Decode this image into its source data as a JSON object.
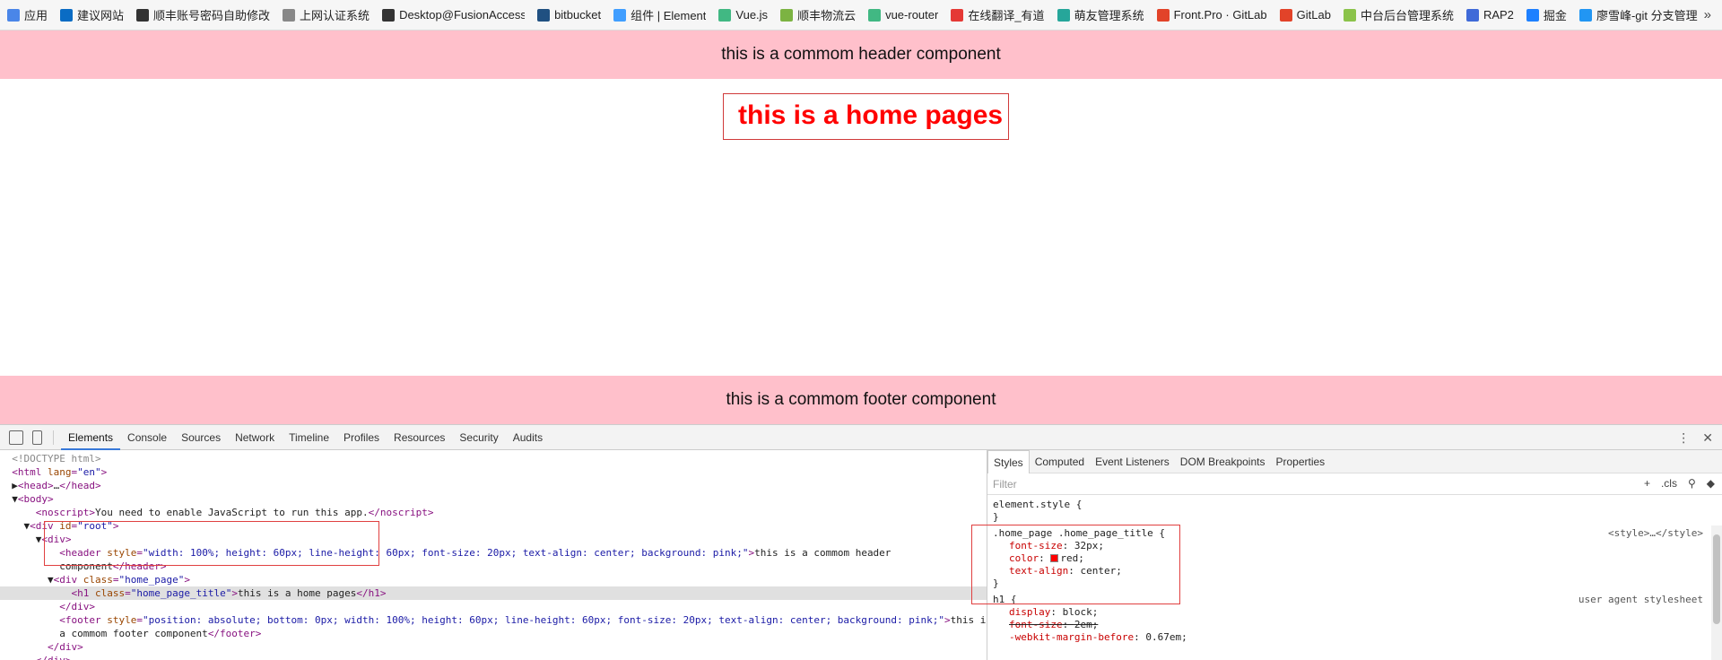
{
  "bookmarks": [
    {
      "label": "应用",
      "icon": "apps-grid-icon",
      "color": "#4a86e8"
    },
    {
      "label": "建议网站",
      "icon": "bing-icon",
      "color": "#0a6cc4"
    },
    {
      "label": "顺丰账号密码自助修改",
      "icon": "sf-icon",
      "color": "#333333"
    },
    {
      "label": "上网认证系统",
      "icon": "page-icon",
      "color": "#888888"
    },
    {
      "label": "Desktop@FusionAccess",
      "icon": "sf-icon",
      "color": "#333333"
    },
    {
      "label": "bitbucket",
      "icon": "bitbucket-icon",
      "color": "#205081"
    },
    {
      "label": "组件 | Element",
      "icon": "element-icon",
      "color": "#409eff"
    },
    {
      "label": "Vue.js",
      "icon": "vue-icon",
      "color": "#41b883"
    },
    {
      "label": "顺丰物流云",
      "icon": "cloud-icon",
      "color": "#7cb342"
    },
    {
      "label": "vue-router",
      "icon": "vue-icon",
      "color": "#41b883"
    },
    {
      "label": "在线翻译_有道",
      "icon": "youdao-icon",
      "color": "#e53935"
    },
    {
      "label": "萌友管理系统",
      "icon": "mengyou-icon",
      "color": "#26a69a"
    },
    {
      "label": "Front.Pro · GitLab",
      "icon": "gitlab-icon",
      "color": "#e24329"
    },
    {
      "label": "GitLab",
      "icon": "gitlab-icon",
      "color": "#e24329"
    },
    {
      "label": "中台后台管理系统",
      "icon": "leaf-icon",
      "color": "#8bc34a"
    },
    {
      "label": "RAP2",
      "icon": "rap-icon",
      "color": "#3f6ad8"
    },
    {
      "label": "掘金",
      "icon": "juejin-icon",
      "color": "#1e80ff"
    },
    {
      "label": "廖雪峰-git 分支管理",
      "icon": "liao-icon",
      "color": "#2196f3"
    }
  ],
  "bookmarks_more": "»",
  "page": {
    "header_text": "this is a commom header component",
    "home_title": "this is a home pages",
    "footer_text": "this is a commom footer component"
  },
  "devtools": {
    "tabs": [
      "Elements",
      "Console",
      "Sources",
      "Network",
      "Timeline",
      "Profiles",
      "Resources",
      "Security",
      "Audits"
    ],
    "active_tab": "Elements",
    "dom_lines": [
      {
        "indent": "  ",
        "parts": [
          [
            "cmt",
            "<!DOCTYPE html>"
          ]
        ]
      },
      {
        "indent": "  ",
        "parts": [
          [
            "tag",
            "<html "
          ],
          [
            "attr",
            "lang"
          ],
          [
            "tag",
            "="
          ],
          [
            "val",
            "\"en\""
          ],
          [
            "tag",
            ">"
          ]
        ]
      },
      {
        "indent": "  ▶",
        "parts": [
          [
            "tag",
            "<head>"
          ],
          [
            "txtc",
            "…"
          ],
          [
            "tag",
            "</head>"
          ]
        ]
      },
      {
        "indent": "  ▼",
        "parts": [
          [
            "tag",
            "<body>"
          ]
        ]
      },
      {
        "indent": "      ",
        "parts": [
          [
            "tag",
            "<noscript>"
          ],
          [
            "txtc",
            "You need to enable JavaScript to run this app."
          ],
          [
            "tag",
            "</noscript>"
          ]
        ]
      },
      {
        "indent": "    ▼",
        "parts": [
          [
            "tag",
            "<div "
          ],
          [
            "attr",
            "id"
          ],
          [
            "tag",
            "="
          ],
          [
            "val",
            "\"root\""
          ],
          [
            "tag",
            ">"
          ]
        ]
      },
      {
        "indent": "      ▼",
        "parts": [
          [
            "tag",
            "<div>"
          ]
        ]
      },
      {
        "indent": "          ",
        "parts": [
          [
            "tag",
            "<header "
          ],
          [
            "attr",
            "style"
          ],
          [
            "tag",
            "="
          ],
          [
            "val",
            "\"width: 100%; height: 60px; line-height: 60px; font-size: 20px; text-align: center; background: pink;\""
          ],
          [
            "tag",
            ">"
          ],
          [
            "txtc",
            "this is a commom header"
          ]
        ]
      },
      {
        "indent": "          ",
        "parts": [
          [
            "txtc",
            "component"
          ],
          [
            "tag",
            "</header>"
          ]
        ]
      },
      {
        "indent": "        ▼",
        "parts": [
          [
            "tag",
            "<div "
          ],
          [
            "attr",
            "class"
          ],
          [
            "tag",
            "="
          ],
          [
            "val",
            "\"home_page\""
          ],
          [
            "tag",
            ">"
          ]
        ]
      },
      {
        "indent": "            ",
        "parts": [
          [
            "tag",
            "<h1 "
          ],
          [
            "attr",
            "class"
          ],
          [
            "tag",
            "="
          ],
          [
            "val",
            "\"home_page_title\""
          ],
          [
            "tag",
            ">"
          ],
          [
            "txtc",
            "this is a home pages"
          ],
          [
            "tag",
            "</h1>"
          ]
        ],
        "selected": true
      },
      {
        "indent": "          ",
        "parts": [
          [
            "tag",
            "</div>"
          ]
        ]
      },
      {
        "indent": "          ",
        "parts": [
          [
            "tag",
            "<footer "
          ],
          [
            "attr",
            "style"
          ],
          [
            "tag",
            "="
          ],
          [
            "val",
            "\"position: absolute; bottom: 0px; width: 100%; height: 60px; line-height: 60px; font-size: 20px; text-align: center; background: pink;\""
          ],
          [
            "tag",
            ">"
          ],
          [
            "txtc",
            "this is"
          ]
        ]
      },
      {
        "indent": "          ",
        "parts": [
          [
            "txtc",
            "a commom footer component"
          ],
          [
            "tag",
            "</footer>"
          ]
        ]
      },
      {
        "indent": "        ",
        "parts": [
          [
            "tag",
            "</div>"
          ]
        ]
      },
      {
        "indent": "      ",
        "parts": [
          [
            "tag",
            "</div>"
          ]
        ]
      }
    ],
    "styles_tabs": [
      "Styles",
      "Computed",
      "Event Listeners",
      "DOM Breakpoints",
      "Properties"
    ],
    "styles_active": "Styles",
    "filter_placeholder": "Filter",
    "filter_tools": [
      "+",
      ".cls",
      "pin-icon",
      "palette-icon"
    ],
    "rules": {
      "element_style_open": "element.style {",
      "element_style_close": "}",
      "rule1_selector": ".home_page .home_page_title {",
      "rule1_source": "<style>…</style>",
      "rule1_props": [
        {
          "name": "font-size",
          "value": "32px;"
        },
        {
          "name": "color",
          "value": "red;",
          "swatch": "#ff0000"
        },
        {
          "name": "text-align",
          "value": "center;"
        }
      ],
      "rule1_close": "}",
      "rule2_selector": "h1 {",
      "rule2_source": "user agent stylesheet",
      "rule2_props": [
        {
          "name": "display",
          "value": "block;"
        },
        {
          "name": "font-size",
          "value": "2em;",
          "strike": true
        },
        {
          "name": "-webkit-margin-before",
          "value": "0.67em;"
        }
      ]
    }
  }
}
